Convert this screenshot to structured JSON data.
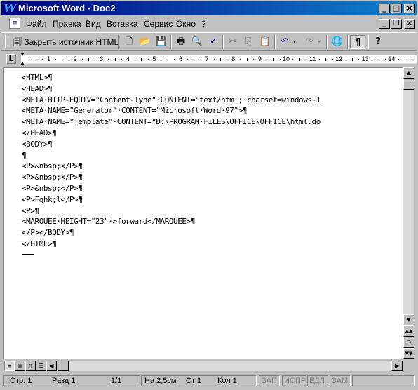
{
  "titlebar": {
    "app_icon": "W",
    "title": "Microsoft Word - Doc2",
    "minimize": "_",
    "maximize": "□",
    "close": "×"
  },
  "menubar": {
    "items": [
      "Файл",
      "Правка",
      "Вид",
      "Вставка",
      "Сервис",
      "Окно",
      "?"
    ],
    "mdi": {
      "minimize": "_",
      "restore": "❐",
      "close": "×"
    }
  },
  "toolbar": {
    "close_html_label": "Закрыть источник HTML",
    "icons": [
      "new-document-icon",
      "open-folder-icon",
      "save-icon",
      "print-icon",
      "print-preview-icon",
      "spelling-icon",
      "cut-icon",
      "copy-icon",
      "paste-icon",
      "undo-icon",
      "redo-icon",
      "web-browse-icon",
      "show-formatting-icon",
      "help-icon"
    ]
  },
  "ruler": {
    "numbers": [
      "1",
      "1",
      "2",
      "3",
      "4",
      "5",
      "6",
      "7",
      "8",
      "9",
      "10",
      "11",
      "12",
      "13",
      "14"
    ]
  },
  "document": {
    "lines": [
      "<HTML>¶",
      "<HEAD>¶",
      "<META·HTTP-EQUIV=\"Content-Type\"·CONTENT=\"text/html;·charset=windows-1",
      "<META·NAME=\"Generator\"·CONTENT=\"Microsoft·Word·97\">¶",
      "<META·NAME=\"Template\"·CONTENT=\"D:\\PROGRAM·FILES\\OFFICE\\OFFICE\\html.do",
      "</HEAD>¶",
      "<BODY>¶",
      "¶",
      "<P>&nbsp;</P>¶",
      "<P>&nbsp;</P>¶",
      "<P>&nbsp;</P>¶",
      "<P>Fghk;l</P>¶",
      "<P>¶",
      "<MARQUEE·HEIGHT=\"23\"·>forward</MARQUEE>¶",
      "</P></BODY>¶",
      "</HTML>¶"
    ]
  },
  "statusbar": {
    "page": "Стр. 1",
    "section": "Разд 1",
    "pages": "1/1",
    "at": "На 2,5см",
    "line": "Ст 1",
    "col": "Кол 1",
    "rec": "ЗАП",
    "trk": "ИСПР",
    "ext": "ВДЛ",
    "ovr": "ЗАМ"
  }
}
